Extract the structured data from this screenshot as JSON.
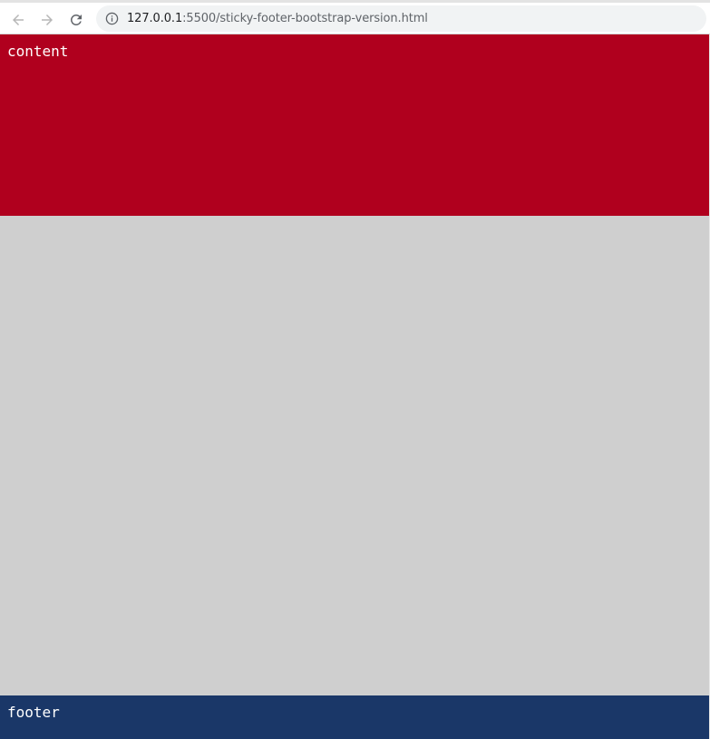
{
  "browser": {
    "url_host": "127.0.0.1",
    "url_path": ":5500/sticky-footer-bootstrap-version.html"
  },
  "page": {
    "content_label": "content",
    "footer_label": "footer"
  },
  "colors": {
    "content_bg": "#b0001e",
    "body_bg": "#cfcfcf",
    "footer_bg": "#1a3768",
    "text": "#ffffff"
  },
  "icons": {
    "back": "arrow-left-icon",
    "forward": "arrow-right-icon",
    "reload": "reload-icon",
    "site_info": "info-icon"
  }
}
